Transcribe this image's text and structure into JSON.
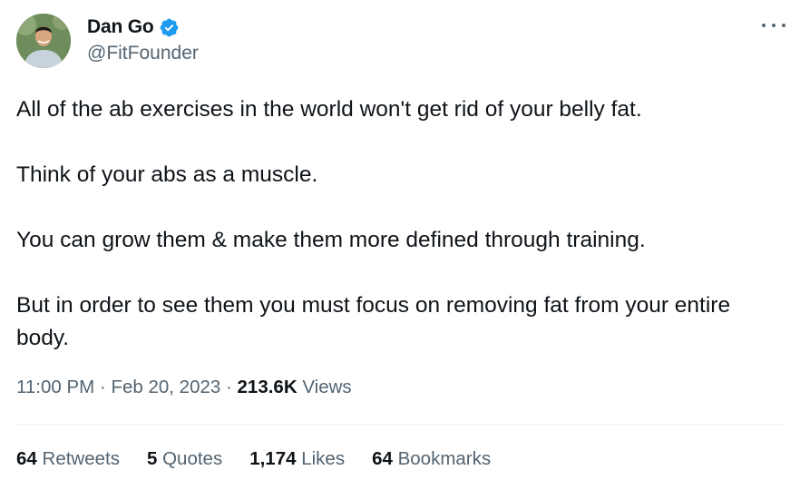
{
  "author": {
    "display_name": "Dan Go",
    "handle": "@FitFounder",
    "verified": true,
    "avatar_icon": "profile-photo"
  },
  "more_icon": "more-horizontal-icon",
  "tweet": {
    "paragraphs": [
      "All of the ab exercises in the world won't get rid of your belly fat.",
      "Think of your abs as a muscle.",
      "You can grow them & make them more defined through training.",
      "But in order to see them you must focus on removing fat from your entire body."
    ]
  },
  "meta": {
    "time": "11:00 PM",
    "separator": "·",
    "date": "Feb 20, 2023",
    "views_count": "213.6K",
    "views_label": "Views"
  },
  "stats": {
    "retweets": {
      "count": "64",
      "label": "Retweets"
    },
    "quotes": {
      "count": "5",
      "label": "Quotes"
    },
    "likes": {
      "count": "1,174",
      "label": "Likes"
    },
    "bookmarks": {
      "count": "64",
      "label": "Bookmarks"
    }
  },
  "colors": {
    "text_primary": "#0f1419",
    "text_secondary": "#536471",
    "verified_blue": "#1d9bf0",
    "divider": "#eff3f4"
  }
}
